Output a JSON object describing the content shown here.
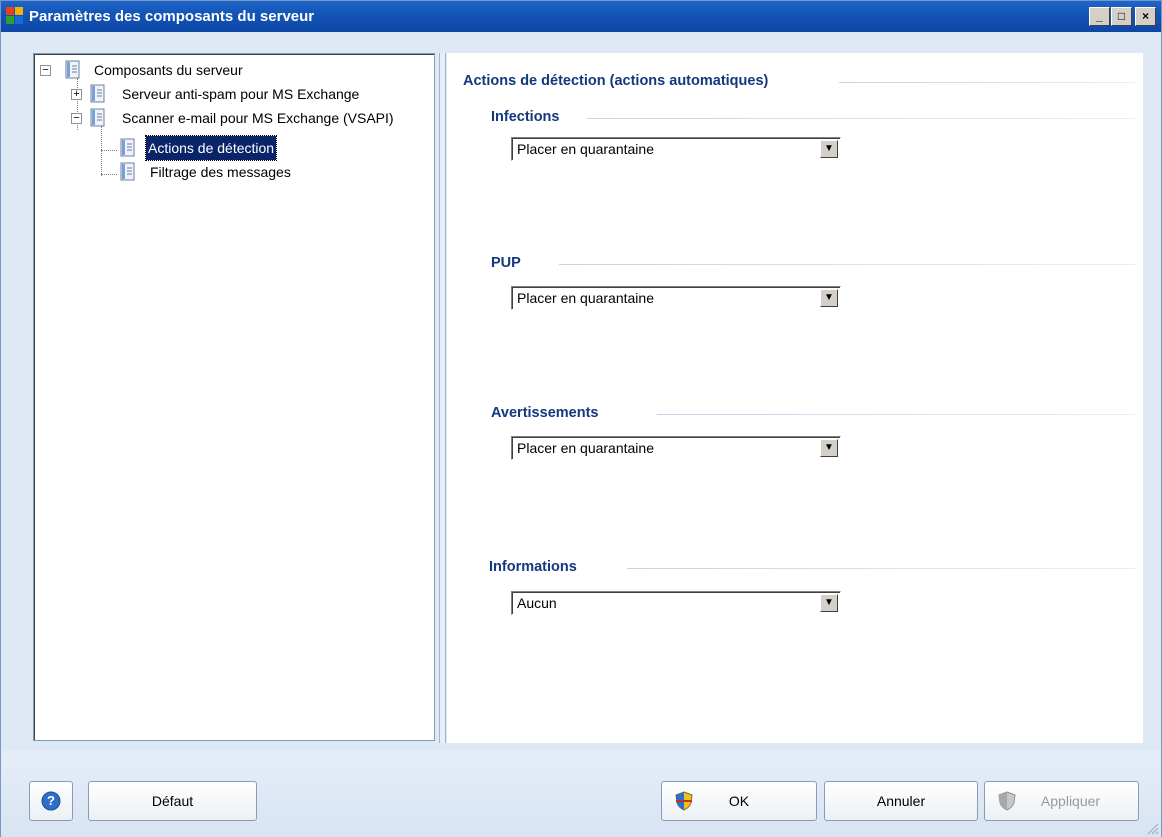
{
  "window": {
    "title": "Paramètres des composants du serveur",
    "minimize_label": "_",
    "maximize_label": "□",
    "close_label": "×"
  },
  "tree": {
    "root": {
      "label": "Composants du serveur",
      "expander": "−"
    },
    "items": [
      {
        "label": "Serveur anti-spam pour MS Exchange",
        "expander": "+"
      },
      {
        "label": "Scanner e-mail pour MS Exchange (VSAPI)",
        "expander": "−"
      }
    ],
    "children": [
      {
        "label": "Actions de détection",
        "selected": true
      },
      {
        "label": "Filtrage des messages",
        "selected": false
      }
    ]
  },
  "content": {
    "title": "Actions de détection (actions automatiques)",
    "sections": [
      {
        "label": "Infections",
        "value": "Placer en quarantaine"
      },
      {
        "label": "PUP",
        "value": "Placer en quarantaine"
      },
      {
        "label": "Avertissements",
        "value": "Placer en quarantaine"
      },
      {
        "label": "Informations",
        "value": "Aucun"
      }
    ]
  },
  "buttons": {
    "help_label": "?",
    "default_label": "Défaut",
    "ok_label": "OK",
    "cancel_label": "Annuler",
    "apply_label": "Appliquer",
    "apply_enabled": false
  },
  "colors": {
    "title_bar": "#1353b6",
    "heading": "#13387d",
    "selection": "#0a246a",
    "window_bg": "#dfe9f5"
  }
}
